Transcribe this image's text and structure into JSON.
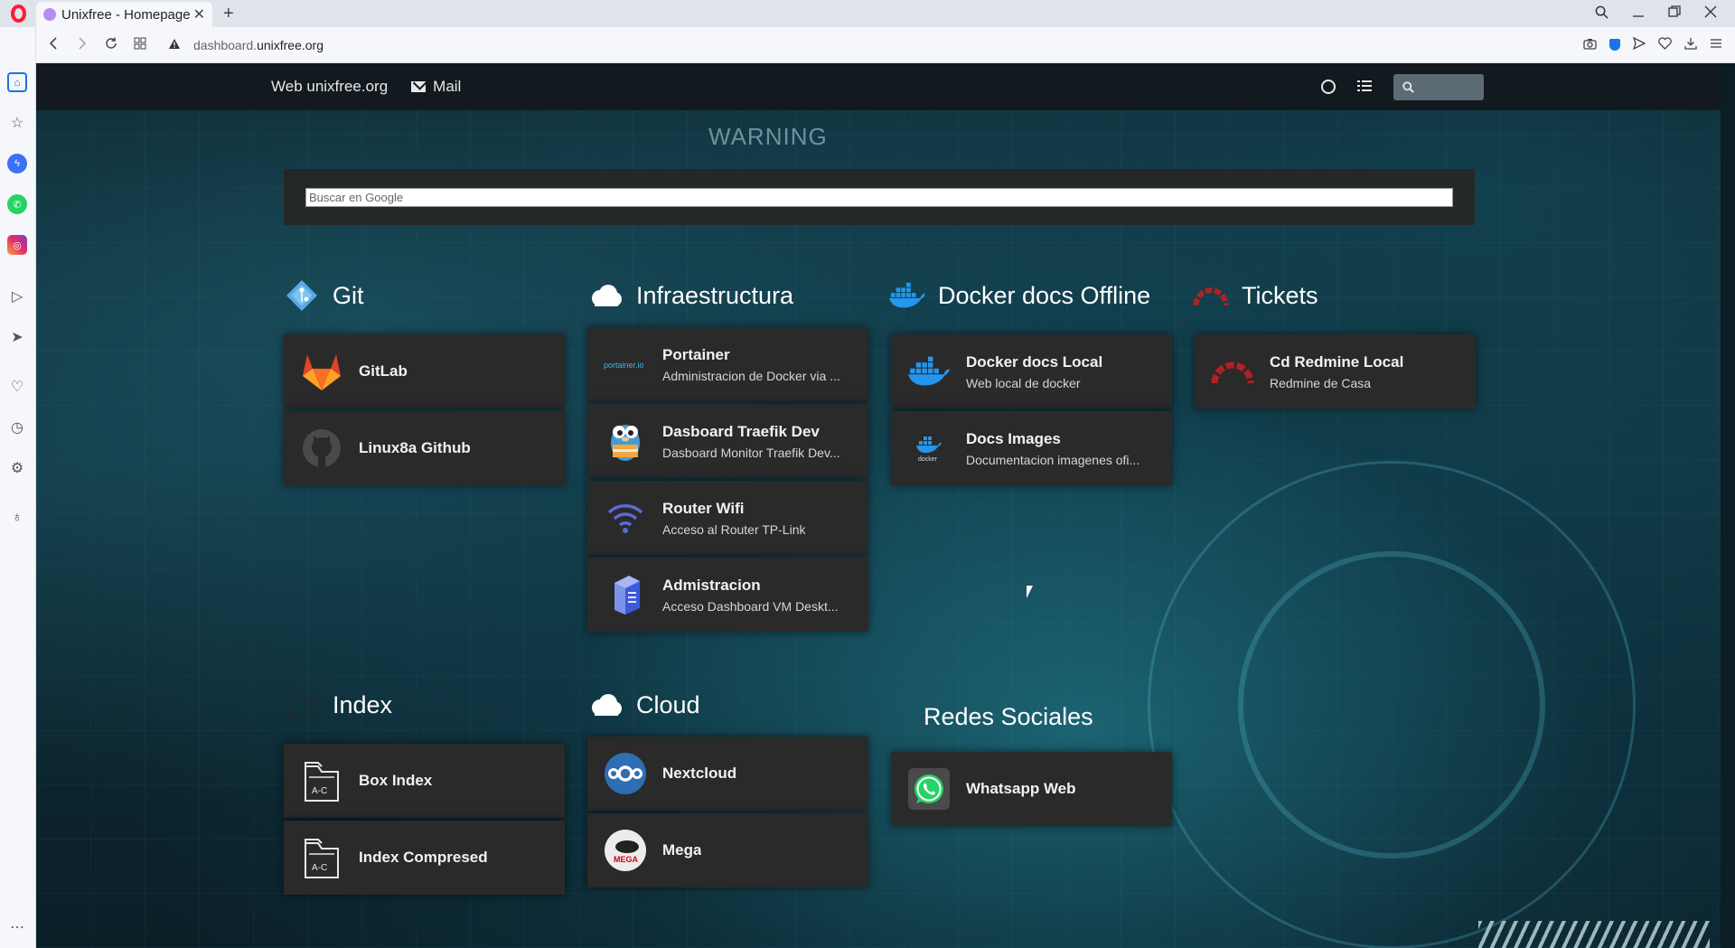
{
  "browser": {
    "tab_title": "Unixfree - Homepage",
    "tab_close": "✕",
    "new_tab": "+",
    "url_prefix": "dashboard.",
    "url_domain": "unixfree.org"
  },
  "topnav": {
    "web_label": "Web unixfree.org",
    "mail_label": "Mail"
  },
  "google_search": {
    "placeholder": "Buscar en Google"
  },
  "background": {
    "warning_text": "WARNING"
  },
  "groups": {
    "git": {
      "title": "Git",
      "items": [
        {
          "title": "GitLab"
        },
        {
          "title": "Linux8a Github"
        }
      ]
    },
    "infra": {
      "title": "Infraestructura",
      "items": [
        {
          "title": "Portainer",
          "subtitle": "Administracion de Docker via ...",
          "icon_text": "portainer.io"
        },
        {
          "title": "Dasboard Traefik Dev",
          "subtitle": "Dasboard Monitor Traefik Dev..."
        },
        {
          "title": "Router Wifi",
          "subtitle": "Acceso al Router TP-Link"
        },
        {
          "title": "Admistracion",
          "subtitle": "Acceso Dashboard VM Deskt..."
        }
      ]
    },
    "docker": {
      "title": "Docker docs Offline",
      "items": [
        {
          "title": "Docker docs Local",
          "subtitle": "Web local de docker"
        },
        {
          "title": "Docs Images",
          "subtitle": "Documentacion imagenes ofi...",
          "icon_text": "docker"
        }
      ]
    },
    "tickets": {
      "title": "Tickets",
      "items": [
        {
          "title": "Cd Redmine Local",
          "subtitle": "Redmine de Casa"
        }
      ]
    },
    "index": {
      "title": "Index",
      "items": [
        {
          "title": "Box Index",
          "icon_text": "A-C"
        },
        {
          "title": "Index Compresed",
          "icon_text": "A-C"
        }
      ]
    },
    "cloud": {
      "title": "Cloud",
      "items": [
        {
          "title": "Nextcloud"
        },
        {
          "title": "Mega",
          "icon_text": "MEGA"
        }
      ]
    },
    "social": {
      "title": "Redes Sociales",
      "items": [
        {
          "title": "Whatsapp Web"
        }
      ]
    }
  },
  "colors": {
    "card_bg": "#2a2a2a",
    "nav_bg": "#121a1f",
    "gitlab": "#fc6d26",
    "redmine": "#b32024",
    "docker": "#2496ed",
    "whatsapp": "#25d366"
  }
}
